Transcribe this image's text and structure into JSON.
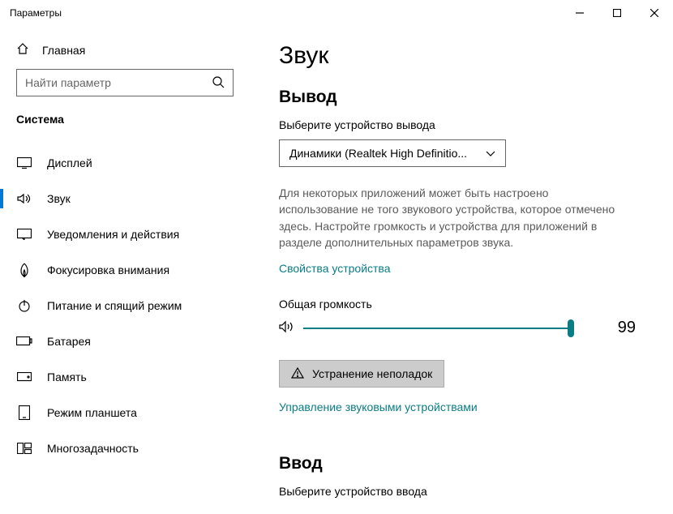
{
  "window": {
    "title": "Параметры"
  },
  "sidebar": {
    "home": "Главная",
    "search_placeholder": "Найти параметр",
    "category": "Система",
    "items": [
      {
        "label": "Дисплей"
      },
      {
        "label": "Звук"
      },
      {
        "label": "Уведомления и действия"
      },
      {
        "label": "Фокусировка внимания"
      },
      {
        "label": "Питание и спящий режим"
      },
      {
        "label": "Батарея"
      },
      {
        "label": "Память"
      },
      {
        "label": "Режим планшета"
      },
      {
        "label": "Многозадачность"
      }
    ]
  },
  "main": {
    "title": "Звук",
    "output_heading": "Вывод",
    "output_device_label": "Выберите устройство вывода",
    "output_device_value": "Динамики (Realtek High Definitio...",
    "output_desc": "Для некоторых приложений может быть настроено использование не того звукового устройства, которое отмечено здесь. Настройте громкость и устройства для приложений в разделе дополнительных параметров звука.",
    "device_props_link": "Свойства устройства",
    "volume_label": "Общая громкость",
    "volume_value": "99",
    "troubleshoot_btn": "Устранение неполадок",
    "manage_link": "Управление звуковыми устройствами",
    "input_heading": "Ввод",
    "input_device_label": "Выберите устройство ввода"
  }
}
